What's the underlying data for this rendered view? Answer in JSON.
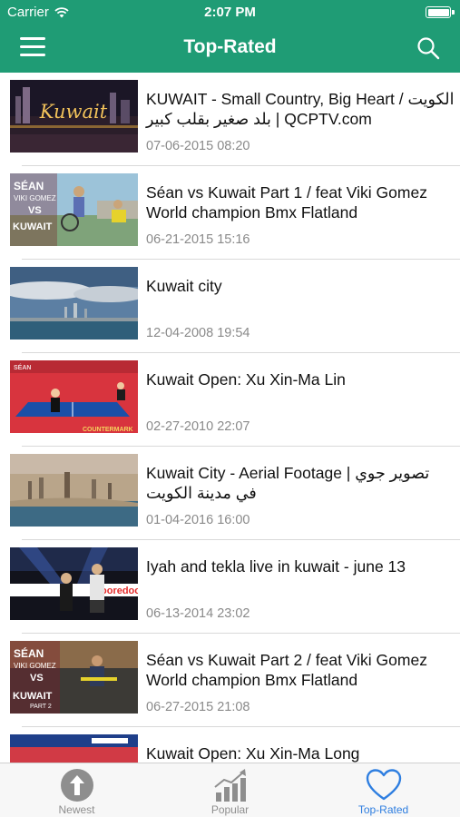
{
  "status_bar": {
    "carrier": "Carrier",
    "time": "2:07 PM"
  },
  "nav": {
    "title": "Top-Rated",
    "menu_icon": "hamburger-menu-icon",
    "search_icon": "search-icon",
    "bar_color": "#1f9c75"
  },
  "videos": [
    {
      "title": "KUWAIT - Small Country, Big Heart / الكويت بلد صغير بقلب كبير | QCPTV.com",
      "date": "07-06-2015 08:20"
    },
    {
      "title": "Séan vs Kuwait Part 1 / feat Viki Gomez World champion Bmx Flatland",
      "date": "06-21-2015 15:16"
    },
    {
      "title": "Kuwait city",
      "date": "12-04-2008 19:54"
    },
    {
      "title": "Kuwait Open: Xu Xin-Ma Lin",
      "date": "02-27-2010 22:07"
    },
    {
      "title": "Kuwait City - Aerial Footage | تصوير جوي في مدينة الكويت",
      "date": "01-04-2016 16:00"
    },
    {
      "title": "Iyah and tekla live in kuwait - june 13",
      "date": "06-13-2014 23:02"
    },
    {
      "title": "Séan vs Kuwait Part 2 / feat Viki Gomez World champion Bmx Flatland",
      "date": "06-27-2015 21:08"
    },
    {
      "title": "Kuwait Open: Xu Xin-Ma Long",
      "date": ""
    }
  ],
  "thumb_text": {
    "kuwait_logo": "Kuwait",
    "sean": "SÉAN",
    "viki": "VIKI GOMEZ",
    "vs": "VS",
    "kuwait": "KUWAIT",
    "part2": "PART 2",
    "countermark": "COUNTERMARK",
    "ooredoo": "ooredoo"
  },
  "tabs": [
    {
      "label": "Newest",
      "icon": "arrow-up-circle-icon",
      "active": false
    },
    {
      "label": "Popular",
      "icon": "bar-chart-trend-icon",
      "active": false
    },
    {
      "label": "Top-Rated",
      "icon": "heart-icon",
      "active": true
    }
  ],
  "colors": {
    "accent": "#1f9c75",
    "active_tab": "#2e7ee0",
    "inactive_tab": "#8e8e8e",
    "date_text": "#8a8a8a"
  }
}
